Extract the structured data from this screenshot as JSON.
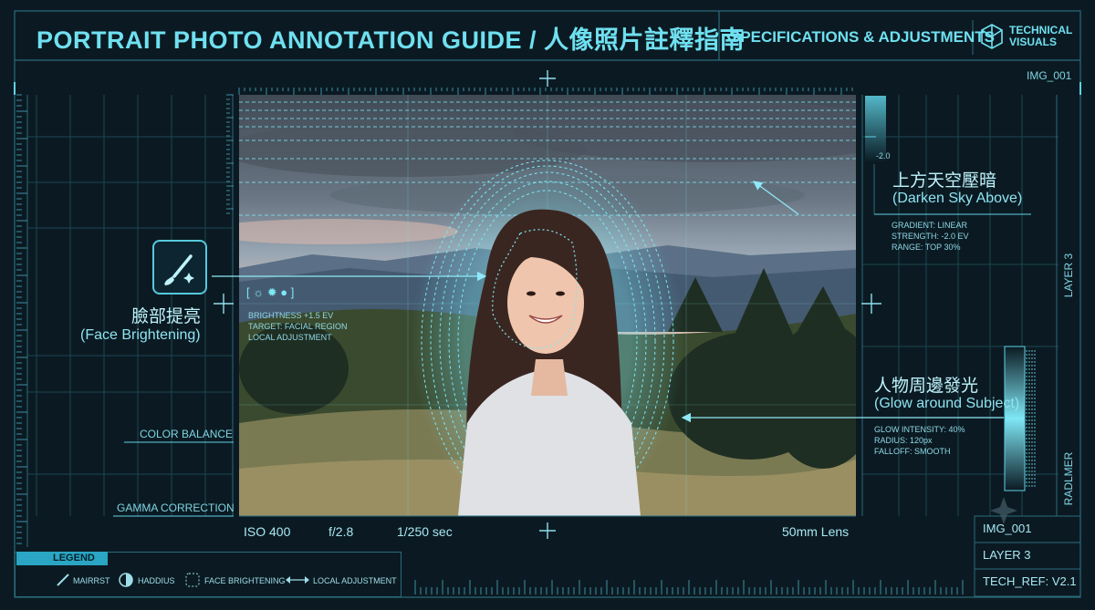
{
  "header": {
    "title": "PORTRAIT PHOTO ANNOTATION GUIDE / 人像照片註釋指南",
    "spec_title": "SPECIFICATIONS & ADJUSTMENTS",
    "brand_line1": "TECHNICAL",
    "brand_line2": "VISUALS",
    "image_id": "IMG_001"
  },
  "annotations": {
    "sky": {
      "zh": "上方天空壓暗",
      "en": "(Darken Sky Above)",
      "specs": [
        "GRADIENT: LINEAR",
        "STRENGTH: -2.0 EV",
        "RANGE: TOP 30%"
      ],
      "gauge_label": "-2.0"
    },
    "face": {
      "zh": "臉部提亮",
      "en": "(Face Brightening)",
      "specs": [
        "BRIGHTNESS +1.5 EV",
        "TARGET: FACIAL REGION",
        "LOCAL ADJUSTMENT"
      ]
    },
    "glow": {
      "zh": "人物周邊發光",
      "en": "(Glow around Subject)",
      "specs": [
        "GLOW INTENSITY: 40%",
        "RADIUS: 120px",
        "FALLOFF: SMOOTH"
      ]
    }
  },
  "side_labels": {
    "color_balance": "COLOR BALANCE",
    "gamma": "GAMMA CORRECTION",
    "layer_right": "LAYER 3",
    "radlmer": "RADLMER"
  },
  "camera": {
    "iso": "ISO 400",
    "aperture": "f/2.8",
    "shutter": "1/250 sec",
    "lens": "50mm Lens"
  },
  "legend": {
    "title": "LEGEND",
    "items": [
      "MAIRRST",
      "HADDIUS",
      "FACE BRIGHTENING",
      "LOCAL ADJUSTMENT"
    ]
  },
  "footer_box": {
    "image_id": "IMG_001",
    "layer": "LAYER 3",
    "tech_ref": "TECH_REF: V2.1"
  },
  "colors": {
    "background": "#0b1a22",
    "accent": "#5fd3e6",
    "grid": "#1d4552"
  }
}
